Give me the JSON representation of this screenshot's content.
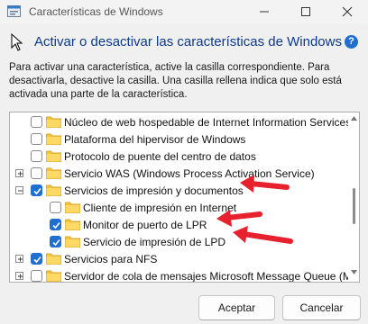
{
  "window": {
    "title": "Características de Windows"
  },
  "heading": "Activar o desactivar las características de Windows",
  "help": "?",
  "description": "Para activar una característica, active la casilla correspondiente. Para desactivarla, desactive la casilla. Una casilla rellena indica que solo está activada una parte de la característica.",
  "tree": {
    "items": [
      {
        "label": "Núcleo de web hospedable de Internet Information Services",
        "checked": false,
        "expander": false
      },
      {
        "label": "Plataforma del hipervisor de Windows",
        "checked": false,
        "expander": false
      },
      {
        "label": "Protocolo de puente del centro de datos",
        "checked": false,
        "expander": false
      },
      {
        "label": "Servicio WAS (Windows Process Activation Service)",
        "checked": false,
        "expander": "+"
      },
      {
        "label": "Servicios de impresión y documentos",
        "checked": true,
        "expander": "−"
      },
      {
        "label": "Cliente de impresión en Internet",
        "checked": false,
        "expander": false
      },
      {
        "label": "Monitor de puerto de LPR",
        "checked": true,
        "expander": false
      },
      {
        "label": "Servicio de impresión de LPD",
        "checked": true,
        "expander": false
      },
      {
        "label": "Servicios para NFS",
        "checked": true,
        "expander": "+"
      },
      {
        "label": "Servidor de cola de mensajes Microsoft Message Queue (MS",
        "checked": false,
        "expander": "+"
      }
    ]
  },
  "buttons": {
    "ok": "Aceptar",
    "cancel": "Cancelar"
  },
  "colors": {
    "accent": "#1f6fd0",
    "annotation": "#e8212e",
    "folder": "#f4c542"
  }
}
